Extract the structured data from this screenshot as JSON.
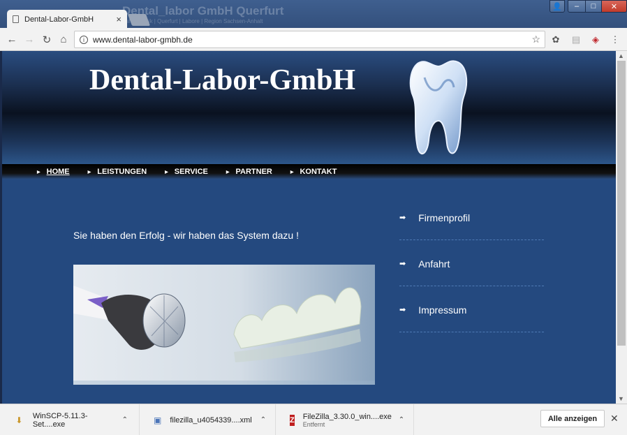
{
  "browser": {
    "tab_title": "Dental-Labor-GmbH",
    "tab_close": "×",
    "background_tab_ghost_title": "Dental_labor GmbH Querfurt",
    "background_tab_ghost_subtitle": "Zahntechnik | Querfurt | Labore | Region Sachsen-Anhalt",
    "url": "www.dental-labor-gmbh.de",
    "nav": {
      "back": "←",
      "forward": "→",
      "reload": "↻",
      "home": "⌂"
    },
    "window_controls": {
      "user": "👤",
      "minimize": "–",
      "maximize": "□",
      "close": "✕"
    },
    "extensions": [
      "✿",
      "▤",
      "◈",
      "⋮"
    ]
  },
  "site": {
    "title": "Dental-Labor-GmbH",
    "nav_items": [
      {
        "label": "HOME",
        "active": true
      },
      {
        "label": "LEISTUNGEN",
        "active": false
      },
      {
        "label": "SERVICE",
        "active": false
      },
      {
        "label": "PARTNER",
        "active": false
      },
      {
        "label": "KONTAKT",
        "active": false
      }
    ],
    "tagline": "Sie haben den Erfolg - wir haben das System dazu !",
    "side_links": [
      "Firmenprofil",
      "Anfahrt",
      "Impressum"
    ],
    "colors": {
      "page_bg": "#24497f",
      "header_dark": "#0a1220",
      "link_border": "#4f7ab5"
    }
  },
  "downloads": {
    "items": [
      {
        "name": "WinSCP-5.11.3-Set....exe",
        "sub": "",
        "icon": "installer-icon"
      },
      {
        "name": "filezilla_u4054339....xml",
        "sub": "",
        "icon": "file-icon"
      },
      {
        "name": "FileZilla_3.30.0_win....exe",
        "sub": "Entfernt",
        "icon": "filezilla-icon"
      }
    ],
    "show_all": "Alle anzeigen",
    "close": "✕"
  }
}
